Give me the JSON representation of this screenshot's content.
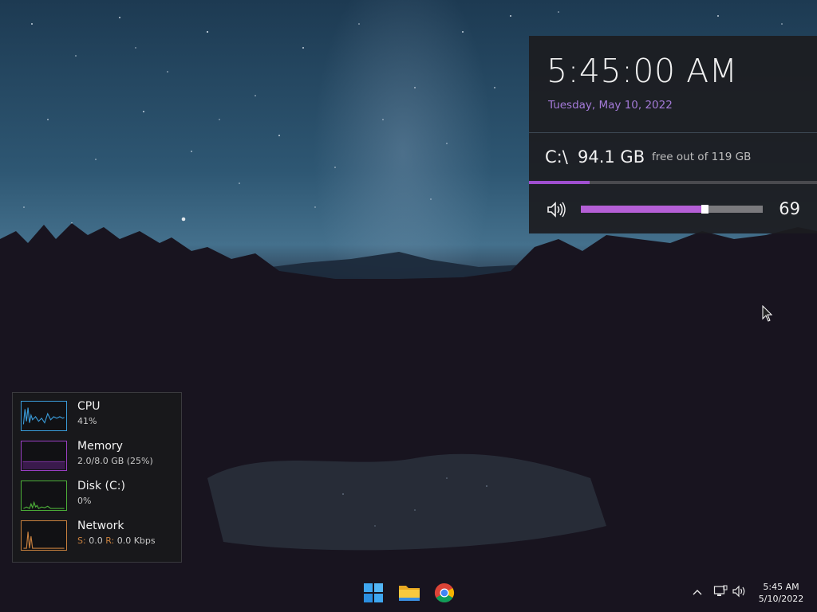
{
  "clock": {
    "time": "5:45:00 AM",
    "date": "Tuesday, May 10, 2022"
  },
  "disk": {
    "drive": "C:\\",
    "free": "94.1 GB",
    "total_text": "free out of 119 GB",
    "used_fraction": 0.21
  },
  "volume": {
    "icon": "speaker-icon",
    "level": 69,
    "level_text": "69"
  },
  "performance": [
    {
      "name": "CPU",
      "value": "41%",
      "color": "#3a9bd8",
      "icon": "cpu-graph"
    },
    {
      "name": "Memory",
      "value": "2.0/8.0 GB (25%)",
      "color": "#9a3fc4",
      "icon": "memory-graph"
    },
    {
      "name": "Disk (C:)",
      "value": "0%",
      "color": "#4cae38",
      "icon": "disk-graph"
    },
    {
      "name": "Network",
      "value_s_label": "S:",
      "value_s": " 0.0 ",
      "value_r_label": "R:",
      "value_r": " 0.0 Kbps",
      "color": "#c8803e",
      "icon": "network-graph"
    }
  ],
  "taskbar": {
    "apps": [
      "start-icon",
      "file-explorer-icon",
      "chrome-icon"
    ],
    "tray": {
      "time": "5:45 AM",
      "date": "5/10/2022"
    }
  },
  "colors": {
    "accent_purple": "#a04fd0",
    "date_purple": "#a47ad8"
  }
}
